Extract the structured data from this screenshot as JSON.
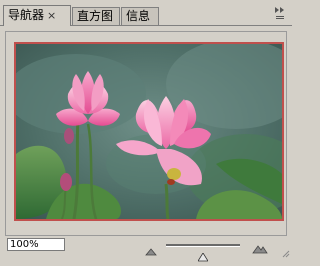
{
  "tabs": [
    {
      "label": "导航器",
      "active": true,
      "closable": true
    },
    {
      "label": "直方图",
      "active": false
    },
    {
      "label": "信息",
      "active": false
    }
  ],
  "close_glyph": "×",
  "panel_menu_glyph": "▸▸",
  "zoom": {
    "value": "100%",
    "slider_position": 0.5
  },
  "preview": {
    "subject": "pink lotus flowers",
    "frame_color": "#c0504d"
  },
  "icons": {
    "zoom_out": "small-mountain-icon",
    "zoom_in": "large-mountain-icon",
    "panel_menu": "panel-menu-icon",
    "resize": "resize-grip-icon"
  }
}
